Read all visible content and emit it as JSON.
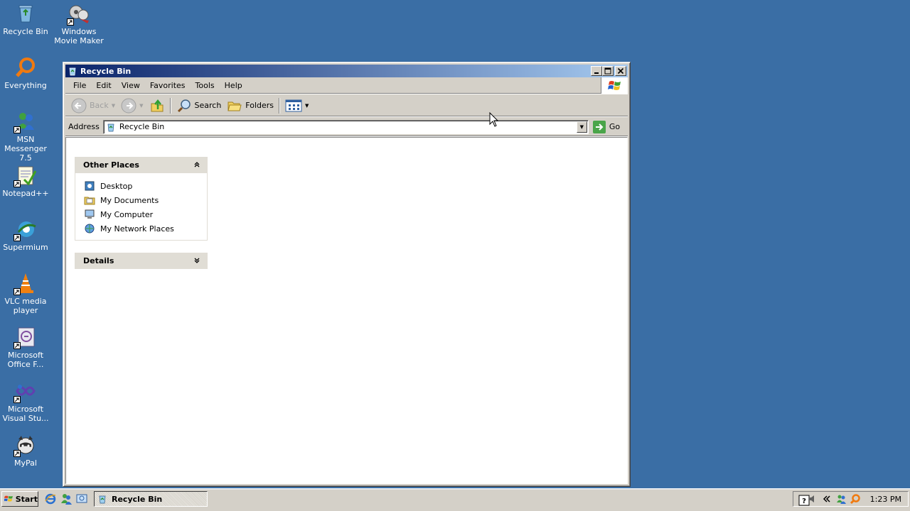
{
  "desktop": {
    "icons": [
      {
        "label": "Recycle Bin",
        "icon": "recycle-bin-icon"
      },
      {
        "label": "Windows Movie Maker",
        "icon": "movie-maker-icon"
      },
      {
        "label": "Everything",
        "icon": "everything-search-icon"
      },
      {
        "label": "MSN Messenger 7.5",
        "icon": "msn-messenger-icon"
      },
      {
        "label": "Notepad++",
        "icon": "notepad-plus-plus-icon"
      },
      {
        "label": "Supermium",
        "icon": "supermium-browser-icon"
      },
      {
        "label": "VLC media player",
        "icon": "vlc-cone-icon"
      },
      {
        "label": "Microsoft Office F...",
        "icon": "office-file-icon"
      },
      {
        "label": "Microsoft Visual Stu...",
        "icon": "visual-studio-icon"
      },
      {
        "label": "MyPal",
        "icon": "mypal-raccoon-icon"
      }
    ]
  },
  "window": {
    "title": "Recycle Bin",
    "menu": [
      "File",
      "Edit",
      "View",
      "Favorites",
      "Tools",
      "Help"
    ],
    "toolbar": {
      "back_label": "Back",
      "search_label": "Search",
      "folders_label": "Folders"
    },
    "address": {
      "label": "Address",
      "value": "Recycle Bin",
      "go_label": "Go"
    },
    "task_panes": {
      "other_places": {
        "title": "Other Places",
        "items": [
          "Desktop",
          "My Documents",
          "My Computer",
          "My Network Places"
        ]
      },
      "details": {
        "title": "Details"
      }
    }
  },
  "taskbar": {
    "start_label": "Start",
    "task_title": "Recycle Bin",
    "clock": "1:23 PM"
  },
  "colors": {
    "desktop": "#3a6ea5",
    "title_gradient_start": "#0a246a",
    "title_gradient_end": "#a6caf0",
    "chrome": "#d4d0c8"
  }
}
